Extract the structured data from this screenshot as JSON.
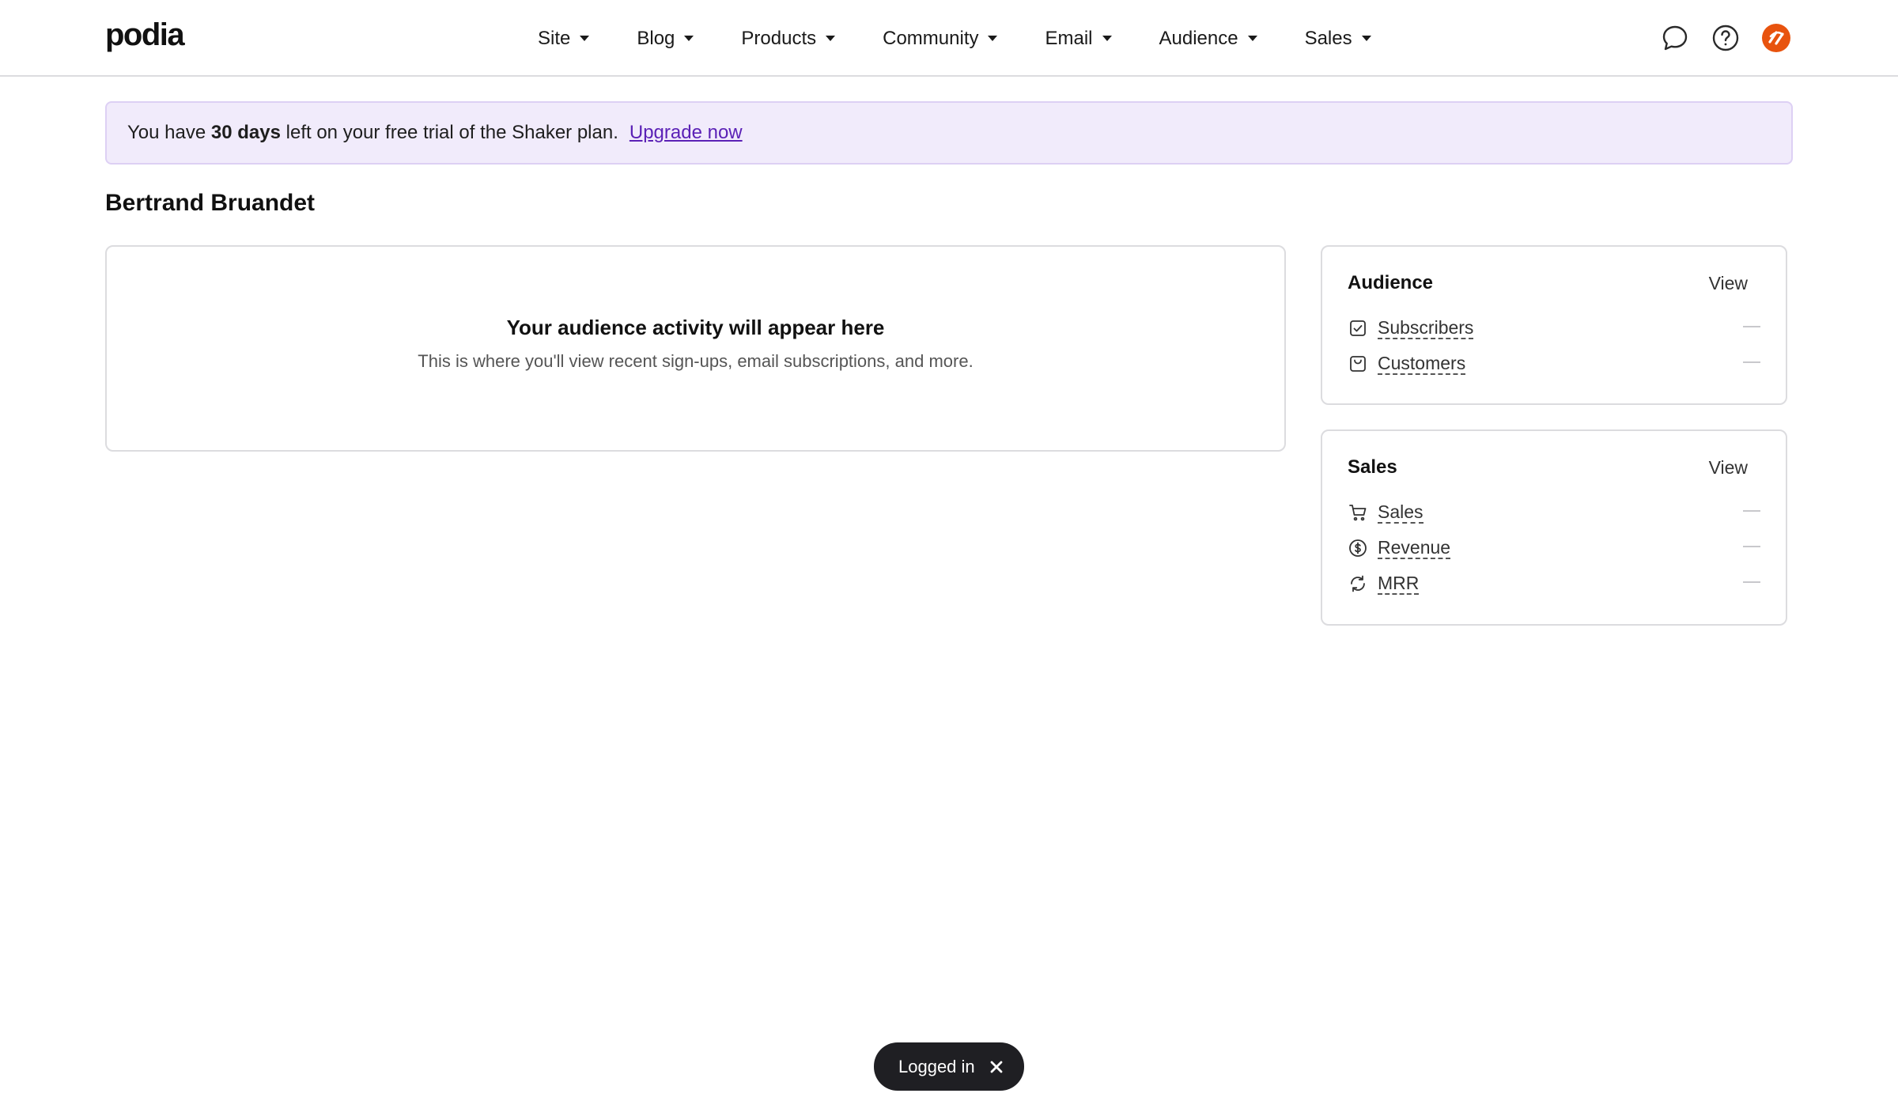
{
  "brand": {
    "logo_text": "podia"
  },
  "nav": {
    "items": [
      {
        "label": "Site"
      },
      {
        "label": "Blog"
      },
      {
        "label": "Products"
      },
      {
        "label": "Community"
      },
      {
        "label": "Email"
      },
      {
        "label": "Audience"
      },
      {
        "label": "Sales"
      }
    ]
  },
  "top_icons": [
    "chat-bubble-icon",
    "help-circle-icon",
    "user-avatar-icon"
  ],
  "colors": {
    "accent": "#5b21b6",
    "banner_bg": "#f1ebfb",
    "avatar": "#e8530e",
    "toast_bg": "#1f1f23"
  },
  "banner": {
    "prefix": "You have",
    "days": "30 days",
    "suffix": "left on your free trial of the Shaker plan.",
    "link": "Upgrade now"
  },
  "page": {
    "title": "Bertrand Bruandet"
  },
  "activity": {
    "heading": "Your audience activity will appear here",
    "subtext": "This is where you'll view recent sign-ups, email subscriptions, and more."
  },
  "audience_card": {
    "title": "Audience",
    "view_label": "View",
    "metrics": [
      {
        "label": "Subscribers",
        "icon": "checkbox-icon",
        "value": "—"
      },
      {
        "label": "Customers",
        "icon": "bag-icon",
        "value": "—"
      }
    ]
  },
  "sales_card": {
    "title": "Sales",
    "view_label": "View",
    "metrics": [
      {
        "label": "Sales",
        "icon": "cart-icon",
        "value": "—"
      },
      {
        "label": "Revenue",
        "icon": "dollar-circle-icon",
        "value": "—"
      },
      {
        "label": "MRR",
        "icon": "refresh-icon",
        "value": "—"
      }
    ]
  },
  "toast": {
    "message": "Logged in"
  }
}
